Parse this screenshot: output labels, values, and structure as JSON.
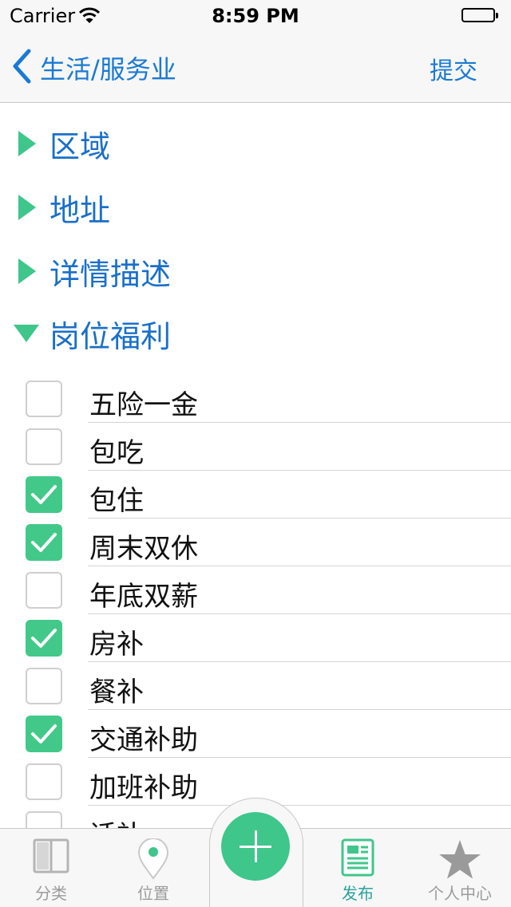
{
  "status_bar": {
    "carrier": "Carrier",
    "time": "8:59 PM"
  },
  "nav": {
    "back_label": "生活/服务业",
    "submit_label": "提交"
  },
  "sections": [
    {
      "label": "区域",
      "expanded": false
    },
    {
      "label": "地址",
      "expanded": false
    },
    {
      "label": "详情描述",
      "expanded": false
    },
    {
      "label": "岗位福利",
      "expanded": true
    }
  ],
  "benefits": [
    {
      "label": "五险一金",
      "checked": false
    },
    {
      "label": "包吃",
      "checked": false
    },
    {
      "label": "包住",
      "checked": true
    },
    {
      "label": "周末双休",
      "checked": true
    },
    {
      "label": "年底双薪",
      "checked": false
    },
    {
      "label": "房补",
      "checked": true
    },
    {
      "label": "餐补",
      "checked": false
    },
    {
      "label": "交通补助",
      "checked": true
    },
    {
      "label": "加班补助",
      "checked": false
    },
    {
      "label": "话补",
      "checked": false
    }
  ],
  "tabbar": {
    "items": [
      {
        "label": "分类",
        "icon": "book-icon"
      },
      {
        "label": "位置",
        "icon": "location-pin-icon"
      },
      {
        "label": "发布",
        "icon": "document-icon",
        "active": true
      },
      {
        "label": "个人中心",
        "icon": "star-icon"
      }
    ],
    "center_icon": "plus-icon"
  },
  "colors": {
    "accent": "#1a7ad4",
    "section_text": "#1a6fc9",
    "check_green": "#42c989",
    "triangle_green": "#3fc68b",
    "active_tab": "#2aa2a0"
  }
}
